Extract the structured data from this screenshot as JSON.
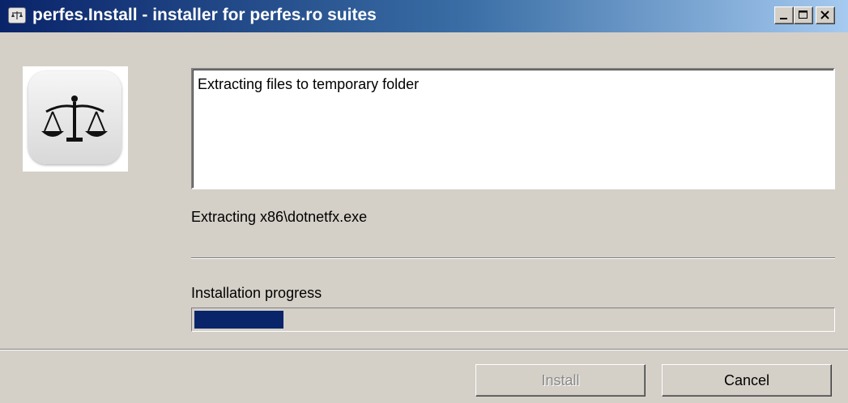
{
  "window": {
    "title": "perfes.Install - installer for perfes.ro suites",
    "controls": [
      "minimize-icon",
      "maximize-icon",
      "close-icon"
    ]
  },
  "logo": {
    "icon": "scales-of-justice-icon"
  },
  "log": {
    "text": "Extracting files to temporary folder"
  },
  "status": {
    "current_action": "Extracting x86\\dotnetfx.exe"
  },
  "progress": {
    "label": "Installation progress",
    "percent": 14
  },
  "buttons": {
    "install_label": "Install",
    "install_enabled": false,
    "cancel_label": "Cancel"
  },
  "colors": {
    "title_gradient_start": "#0a246a",
    "title_gradient_end": "#a6caf0",
    "window_bg": "#d4d0c8",
    "progress_fill": "#0a246a"
  }
}
